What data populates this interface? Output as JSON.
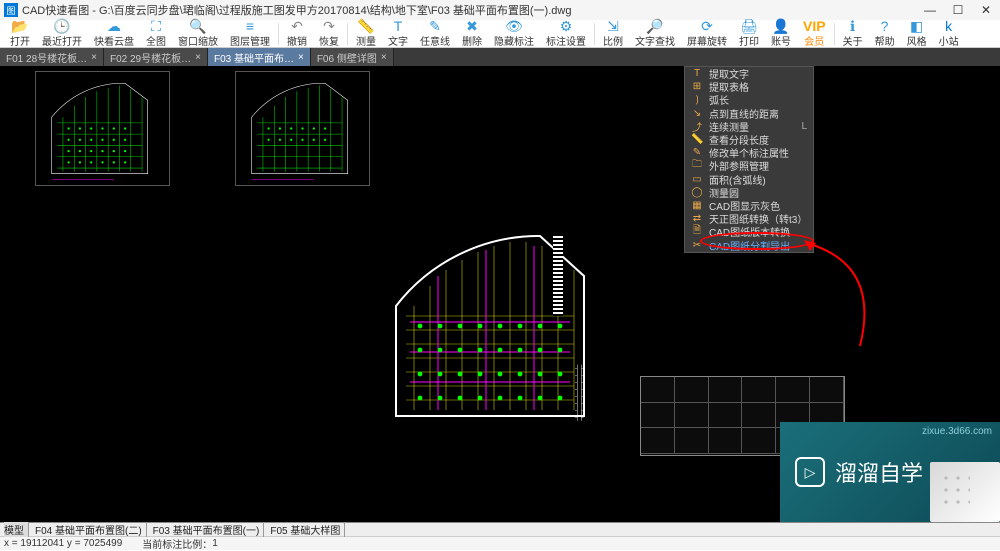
{
  "window": {
    "app": "CAD快速看图",
    "title": "CAD快速看图 - G:\\百度云同步盘\\珺临阁\\过程版施工图发甲方20170814\\结构\\地下室\\F03 基础平面布置图(一).dwg",
    "controls": {
      "min": "—",
      "max": "☐",
      "close": "✕"
    }
  },
  "toolbar": [
    {
      "label": "打开",
      "icon": "📂",
      "color": "#3498db"
    },
    {
      "label": "最近打开",
      "icon": "🕒",
      "color": "#3498db"
    },
    {
      "label": "快看云盘",
      "icon": "☁",
      "color": "#3498db"
    },
    {
      "label": "全图",
      "icon": "⛶",
      "color": "#3498db"
    },
    {
      "label": "窗口缩放",
      "icon": "🔍",
      "color": "#3498db"
    },
    {
      "label": "图层管理",
      "icon": "≡",
      "color": "#3498db"
    },
    {
      "sep": true
    },
    {
      "label": "撤销",
      "icon": "↶",
      "color": "#888"
    },
    {
      "label": "恢复",
      "icon": "↷",
      "color": "#888"
    },
    {
      "sep": true
    },
    {
      "label": "测量",
      "icon": "📏",
      "color": "#3498db"
    },
    {
      "label": "文字",
      "icon": "T",
      "color": "#3498db"
    },
    {
      "label": "任意线",
      "icon": "✎",
      "color": "#3498db"
    },
    {
      "label": "删除",
      "icon": "✖",
      "color": "#3498db"
    },
    {
      "label": "隐藏标注",
      "icon": "👁",
      "color": "#3498db"
    },
    {
      "label": "标注设置",
      "icon": "⚙",
      "color": "#3498db"
    },
    {
      "sep": true
    },
    {
      "label": "比例",
      "icon": "⇲",
      "color": "#3498db"
    },
    {
      "label": "文字查找",
      "icon": "🔎",
      "color": "#3498db"
    },
    {
      "label": "屏幕旋转",
      "icon": "⟳",
      "color": "#3498db"
    },
    {
      "label": "打印",
      "icon": "🖨",
      "color": "#3498db"
    },
    {
      "label": "账号",
      "icon": "👤",
      "color": "#3498db"
    },
    {
      "label": "会员",
      "icon": "VIP",
      "vip": true,
      "highlight": true
    },
    {
      "sep": true
    },
    {
      "label": "关于",
      "icon": "ℹ",
      "color": "#3498db"
    },
    {
      "label": "帮助",
      "icon": "?",
      "color": "#3498db"
    },
    {
      "label": "风格",
      "icon": "◧",
      "color": "#3498db"
    },
    {
      "label": "小站",
      "icon": "k",
      "color": "#0078d7"
    }
  ],
  "tabs": [
    {
      "label": "F01 28号楼花板…",
      "active": false
    },
    {
      "label": "F02 29号楼花板…",
      "active": false
    },
    {
      "label": "F03 基础平面布…",
      "active": true
    },
    {
      "label": "F06 侧壁详图",
      "active": false
    }
  ],
  "dropdown": {
    "items": [
      {
        "icon": "T",
        "label": "提取文字"
      },
      {
        "icon": "⊞",
        "label": "提取表格"
      },
      {
        "icon": "⟯",
        "label": "弧长"
      },
      {
        "icon": "↘",
        "label": "点到直线的距离"
      },
      {
        "icon": "⤴",
        "label": "连续测量",
        "shortcut": "L"
      },
      {
        "icon": "📏",
        "label": "查看分段长度"
      },
      {
        "icon": "✎",
        "label": "修改单个标注属性"
      },
      {
        "icon": "🗀",
        "label": "外部参照管理"
      },
      {
        "icon": "▭",
        "label": "面积(含弧线)"
      },
      {
        "icon": "◯",
        "label": "测量圆"
      },
      {
        "icon": "▦",
        "label": "CAD图显示灰色"
      },
      {
        "icon": "⇄",
        "label": "天正图纸转换（转t3）"
      },
      {
        "icon": "🗎",
        "label": "CAD图纸版本转换"
      },
      {
        "icon": "✂",
        "label": "CAD图纸分割导出",
        "highlight": true
      }
    ]
  },
  "bottom_tabs": {
    "model": "模型",
    "items": [
      "F04 基础平面布置图(二)",
      "F03 基础平面布置图(一)",
      "F05 基础大样图"
    ]
  },
  "status": {
    "coord": "x = 19112041  y = 7025499",
    "ratio_label": "当前标注比例：",
    "ratio_value": "1"
  },
  "watermark": {
    "text": "溜溜自学",
    "url": "zixue.3d66.com"
  }
}
